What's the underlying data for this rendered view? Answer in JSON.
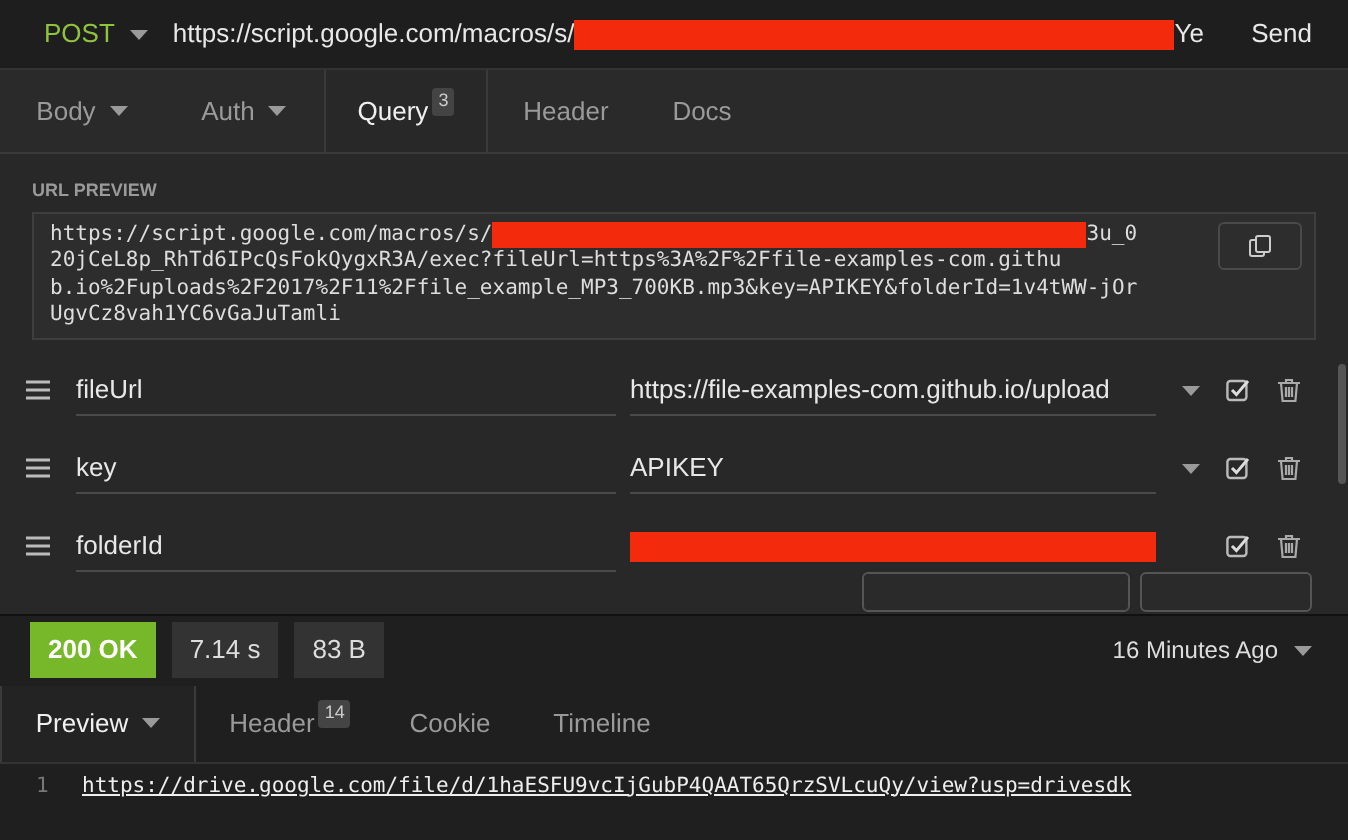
{
  "request": {
    "method": "POST",
    "url_prefix": "https://script.google.com/macros/s/",
    "url_suffix": "Ye",
    "send": "Send"
  },
  "tabs": [
    {
      "label": "Body",
      "dropdown": true,
      "selected": false
    },
    {
      "label": "Auth",
      "dropdown": true,
      "selected": false
    },
    {
      "label": "Query",
      "dropdown": false,
      "badge": "3",
      "selected": true
    },
    {
      "label": "Header",
      "dropdown": false,
      "selected": false
    },
    {
      "label": "Docs",
      "dropdown": false,
      "selected": false
    }
  ],
  "url_preview": {
    "label": "URL PREVIEW",
    "line_1_prefix": "https://script.google.com/macros/s/",
    "line_1_suffix": "3u_0",
    "lines": [
      "20jCeL8p_RhTd6IPcQsFokQygxR3A/exec?fileUrl=https%3A%2F%2Ffile-examples-com.githu",
      "b.io%2Fuploads%2F2017%2F11%2Ffile_example_MP3_700KB.mp3&key=APIKEY&folderId=1v4tWW-jOr",
      "UgvCz8vah1YC6vGaJuTamli"
    ]
  },
  "params": [
    {
      "name": "fileUrl",
      "value": "https://file-examples-com.github.io/upload",
      "redacted": false,
      "checked": true
    },
    {
      "name": "key",
      "value": "APIKEY",
      "redacted": false,
      "checked": true
    },
    {
      "name": "folderId",
      "redacted": true,
      "checked": true
    }
  ],
  "status": {
    "code": "200 OK",
    "time": "7.14 s",
    "size": "83 B",
    "when": "16 Minutes Ago"
  },
  "response_tabs": [
    {
      "label": "Preview",
      "dropdown": true,
      "selected": true
    },
    {
      "label": "Header",
      "dropdown": false,
      "badge": "14",
      "selected": false
    },
    {
      "label": "Cookie",
      "dropdown": false,
      "selected": false
    },
    {
      "label": "Timeline",
      "dropdown": false,
      "selected": false
    }
  ],
  "response_lines": [
    {
      "number": "1",
      "text": "https://drive.google.com/file/d/1haESFU9vcIjGubP4QAAT65QrzSVLcuQy/view?usp=drivesdk"
    }
  ]
}
